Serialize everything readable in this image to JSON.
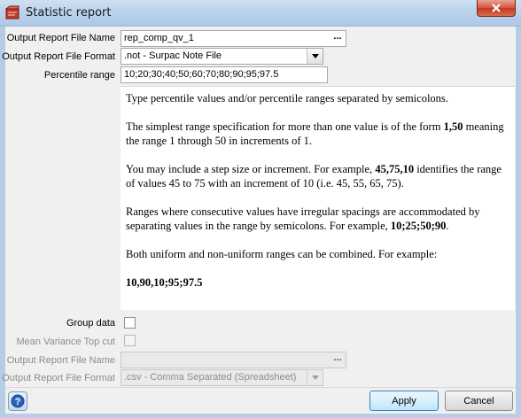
{
  "window": {
    "title": "Statistic report"
  },
  "form": {
    "output_file_name": {
      "label": "Output Report File Name",
      "value": "rep_comp_qv_1",
      "browse": "..."
    },
    "output_file_format": {
      "label": "Output Report File Format",
      "value": ".not - Surpac Note File"
    },
    "percentile_range": {
      "label": "Percentile range",
      "value": "10;20;30;40;50;60;70;80;90;95;97.5"
    },
    "group_data": {
      "label": "Group data",
      "checked": false
    },
    "mean_variance": {
      "label": "Mean Variance Top cut",
      "checked": false,
      "enabled": false
    },
    "output_file_name_2": {
      "label": "Output Report File Name",
      "value": "",
      "browse": "...",
      "enabled": false
    },
    "output_file_format_2": {
      "label": "Output Report File Format",
      "value": ".csv - Comma Separated (Spreadsheet)",
      "enabled": false
    }
  },
  "help": {
    "p1": "Type percentile values and/or percentile ranges separated by semicolons.",
    "p2_a": "The simplest range specification for more than one value is of the form ",
    "p2_b": "1,50",
    "p2_c": " meaning the range 1 through 50 in increments of 1.",
    "p3_a": "You may include a step size or increment. For example, ",
    "p3_b": "45,75,10",
    "p3_c": " identifies the range of values 45 to 75 with an increment of 10 (i.e. 45, 55, 65, 75).",
    "p4_a": "Ranges where consecutive values have irregular spacings are accommodated by separating values in the range by semicolons. For example, ",
    "p4_b": "10;25;50;90",
    "p4_c": ".",
    "p5": "Both uniform and non-uniform ranges can be combined. For example:",
    "p6": "10,90,10;95;97.5"
  },
  "buttons": {
    "apply": "Apply",
    "cancel": "Cancel",
    "help_icon": "question-icon"
  },
  "colors": {
    "titlebar": "#bcd3ec",
    "close": "#c23a20",
    "default_button": "#bee6fd"
  }
}
